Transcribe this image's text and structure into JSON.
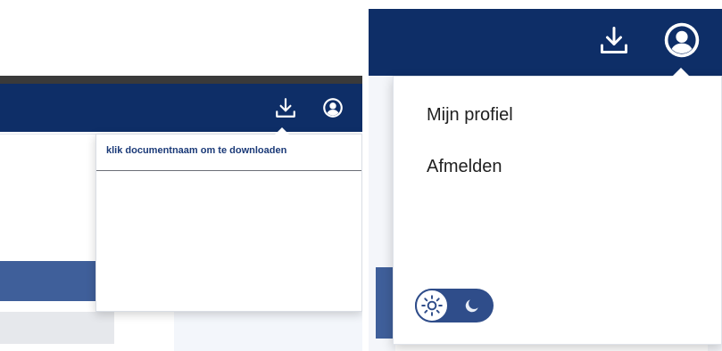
{
  "left_panel": {
    "header": {
      "download_icon": "download-icon",
      "user_icon": "user-circle-icon"
    },
    "download_dropdown": {
      "hint": "klik documentnaam om te downloaden"
    }
  },
  "right_panel": {
    "header": {
      "download_icon": "download-icon",
      "user_icon": "user-circle-icon"
    },
    "user_menu": {
      "items": [
        {
          "label": "Mijn profiel"
        },
        {
          "label": "Afmelden"
        }
      ],
      "theme_toggle": {
        "state": "light",
        "light_icon": "sun-icon",
        "dark_icon": "moon-icon"
      }
    }
  },
  "colors": {
    "header_bg": "#0e2e67",
    "accent_blue": "#3f5f9a",
    "hint_text": "#1b3a78"
  }
}
